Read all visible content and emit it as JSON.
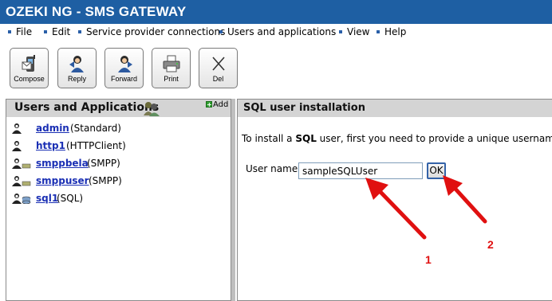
{
  "window": {
    "title": "OZEKI NG - SMS GATEWAY"
  },
  "menu": {
    "items": [
      "File",
      "Edit",
      "Service provider connections",
      "Users and applications",
      "View",
      "Help"
    ]
  },
  "toolbar": {
    "buttons": [
      {
        "label": "Compose",
        "icon": "compose-icon"
      },
      {
        "label": "Reply",
        "icon": "reply-icon"
      },
      {
        "label": "Forward",
        "icon": "forward-icon"
      },
      {
        "label": "Print",
        "icon": "printer-icon"
      },
      {
        "label": "Del",
        "icon": "delete-icon"
      }
    ]
  },
  "left_panel": {
    "title": "Users and Applications",
    "add_label": "Add",
    "users": [
      {
        "name": "admin",
        "type": "(Standard)"
      },
      {
        "name": "http1",
        "type": "(HTTPClient)"
      },
      {
        "name": "smppbela",
        "type": "(SMPP)"
      },
      {
        "name": "smppuser",
        "type": "(SMPP)"
      },
      {
        "name": "sql1",
        "type": "(SQL)"
      }
    ]
  },
  "right_panel": {
    "title": "SQL user installation",
    "instruction_pre": "To install a ",
    "instruction_bold": "SQL",
    "instruction_post": " user, first you need to provide a unique username!",
    "username_label": "User name:",
    "username_value": "sampleSQLUser",
    "ok_label": "OK"
  },
  "annotations": {
    "one": "1",
    "two": "2"
  },
  "colors": {
    "titlebar": "#1e5fa3",
    "link": "#1a2fb4",
    "annotation": "#e01010",
    "panel_header": "#d4d4d4"
  }
}
